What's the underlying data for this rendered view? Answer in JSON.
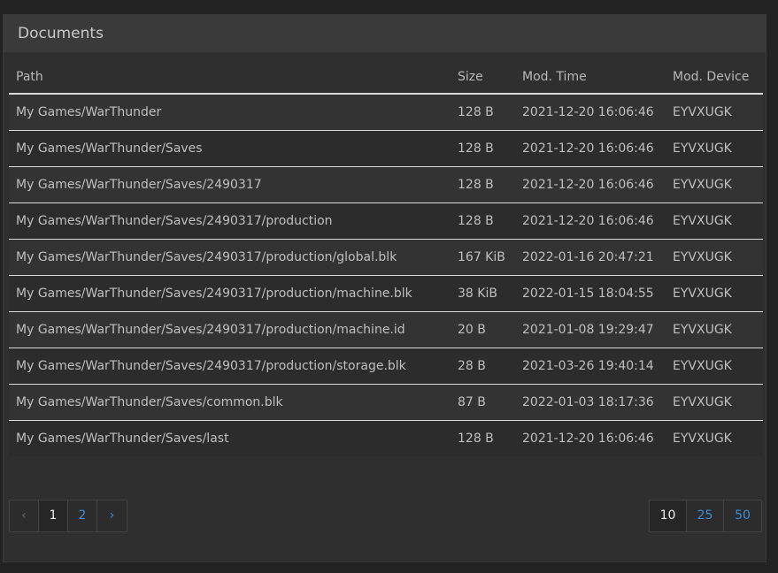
{
  "panel": {
    "title": "Documents"
  },
  "table": {
    "headers": {
      "path": "Path",
      "size": "Size",
      "time": "Mod. Time",
      "device": "Mod. Device"
    },
    "rows": [
      {
        "path": "My Games/WarThunder",
        "size": "128 B",
        "time": "2021-12-20 16:06:46",
        "device": "EYVXUGK"
      },
      {
        "path": "My Games/WarThunder/Saves",
        "size": "128 B",
        "time": "2021-12-20 16:06:46",
        "device": "EYVXUGK"
      },
      {
        "path": "My Games/WarThunder/Saves/2490317",
        "size": "128 B",
        "time": "2021-12-20 16:06:46",
        "device": "EYVXUGK"
      },
      {
        "path": "My Games/WarThunder/Saves/2490317/production",
        "size": "128 B",
        "time": "2021-12-20 16:06:46",
        "device": "EYVXUGK"
      },
      {
        "path": "My Games/WarThunder/Saves/2490317/production/global.blk",
        "size": "167 KiB",
        "time": "2022-01-16 20:47:21",
        "device": "EYVXUGK"
      },
      {
        "path": "My Games/WarThunder/Saves/2490317/production/machine.blk",
        "size": "38 KiB",
        "time": "2022-01-15 18:04:55",
        "device": "EYVXUGK"
      },
      {
        "path": "My Games/WarThunder/Saves/2490317/production/machine.id",
        "size": "20 B",
        "time": "2021-01-08 19:29:47",
        "device": "EYVXUGK"
      },
      {
        "path": "My Games/WarThunder/Saves/2490317/production/storage.blk",
        "size": "28 B",
        "time": "2021-03-26 19:40:14",
        "device": "EYVXUGK"
      },
      {
        "path": "My Games/WarThunder/Saves/common.blk",
        "size": "87 B",
        "time": "2022-01-03 18:17:36",
        "device": "EYVXUGK"
      },
      {
        "path": "My Games/WarThunder/Saves/last",
        "size": "128 B",
        "time": "2021-12-20 16:06:46",
        "device": "EYVXUGK"
      }
    ]
  },
  "pagination": {
    "prev": "‹",
    "pages": [
      "1",
      "2"
    ],
    "current": "1",
    "next": "›"
  },
  "page_size": {
    "options": [
      "10",
      "25",
      "50"
    ],
    "selected": "10"
  },
  "colors": {
    "link": "#3a8ed8",
    "background": "#2f2f2f",
    "heading": "#3a3a3a"
  }
}
